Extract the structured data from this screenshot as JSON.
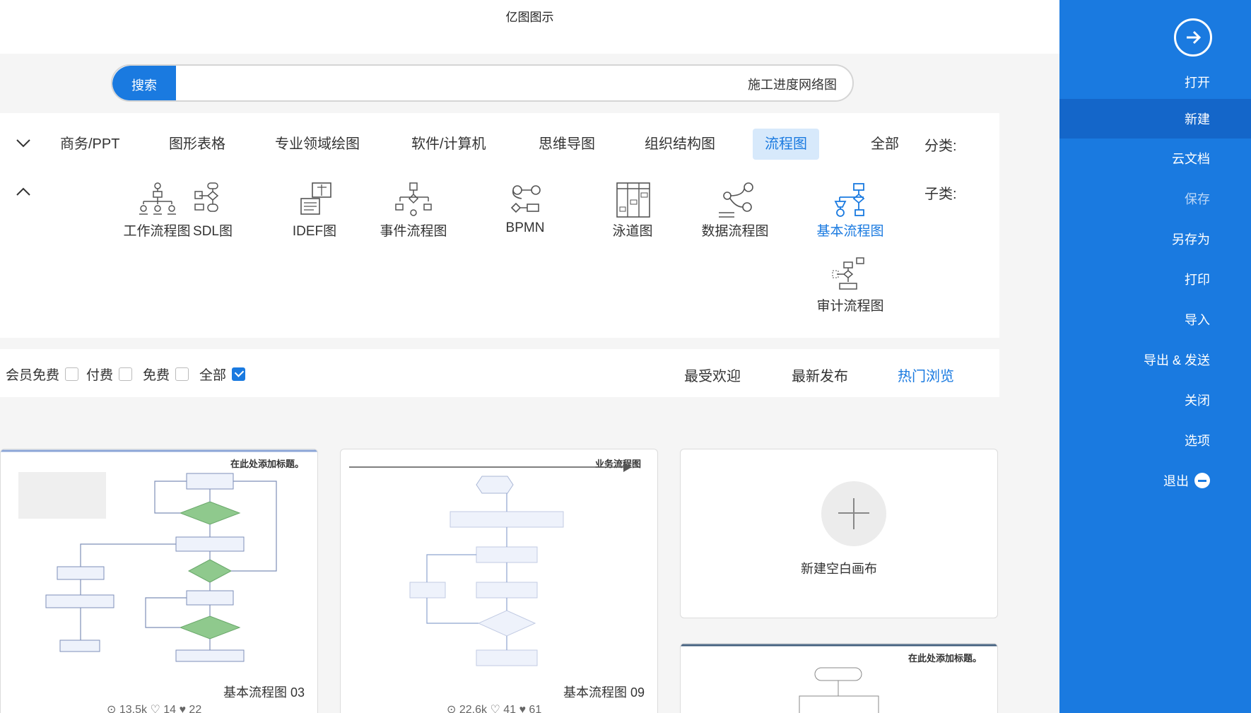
{
  "window": {
    "title": "亿图图示"
  },
  "sidebar": {
    "items": [
      {
        "label": "打开"
      },
      {
        "label": "新建"
      },
      {
        "label": "云文档"
      },
      {
        "label": "保存"
      },
      {
        "label": "另存为"
      },
      {
        "label": "打印"
      },
      {
        "label": "导入"
      },
      {
        "label": "导出 & 发送"
      },
      {
        "label": "关闭"
      },
      {
        "label": "选项"
      },
      {
        "label": "退出"
      }
    ]
  },
  "search": {
    "button_label": "搜索",
    "value": "施工进度网络图"
  },
  "categories": {
    "label": "分类:",
    "items": [
      "全部",
      "流程图",
      "组织结构图",
      "思维导图",
      "软件/计算机",
      "专业领域绘图",
      "图形表格",
      "商务/PPT"
    ],
    "active": "流程图"
  },
  "subcategories": {
    "label": "子类:",
    "items": [
      "基本流程图",
      "数据流程图",
      "泳道图",
      "BPMN",
      "事件流程图",
      "IDEF图",
      "SDL图",
      "工作流程图",
      "审计流程图"
    ],
    "active": "基本流程图"
  },
  "sort_tabs": [
    "热门浏览",
    "最新发布",
    "最受欢迎"
  ],
  "filters": [
    "全部",
    "免费",
    "付费",
    "会员免费"
  ],
  "cards": {
    "blank": {
      "label": "新建空白画布"
    },
    "templates": [
      {
        "title": "基本流程图 09",
        "stats": "⊙ 22.6k   ♡ 41   ♥ 61",
        "mini_title": "业务流程图"
      },
      {
        "title": "基本流程图 03",
        "stats": "⊙ 13.5k   ♡ 14   ♥ 22",
        "mini_title": "在此处添加标题。"
      },
      {
        "mini_title": "在此处添加标题。"
      }
    ]
  }
}
